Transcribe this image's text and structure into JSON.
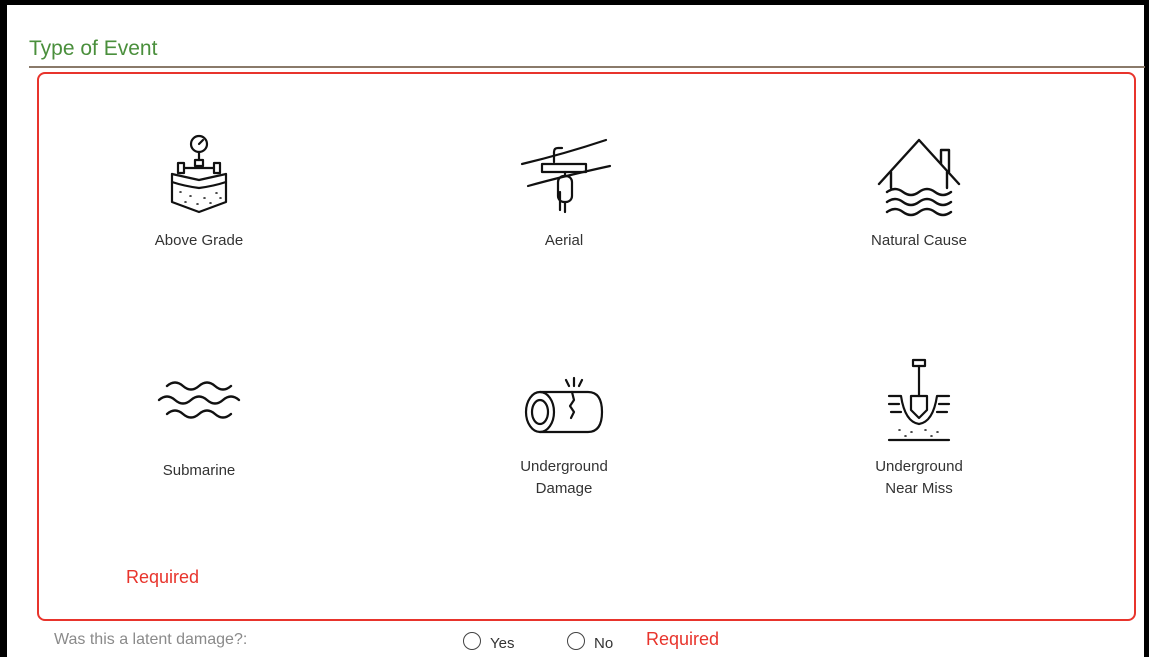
{
  "section": {
    "title": "Type of Event",
    "title_color": "#4a8f3c",
    "rule_color": "#8a7a6a",
    "border_color": "#e8342c"
  },
  "event_types": [
    {
      "label": "Above Grade",
      "icon": "above-grade-icon"
    },
    {
      "label": "Aerial",
      "icon": "aerial-icon"
    },
    {
      "label": "Natural Cause",
      "icon": "natural-cause-icon"
    },
    {
      "label": "Submarine",
      "icon": "submarine-icon"
    },
    {
      "label": "Underground Damage",
      "icon": "underground-damage-icon"
    },
    {
      "label": "Underground Near Miss",
      "icon": "underground-near-miss-icon"
    }
  ],
  "validation": {
    "event_required": "Required",
    "latent_required": "Required",
    "error_color": "#e8342c"
  },
  "latent": {
    "label": "Was this a latent damage?:",
    "options": [
      "Yes",
      "No"
    ]
  }
}
